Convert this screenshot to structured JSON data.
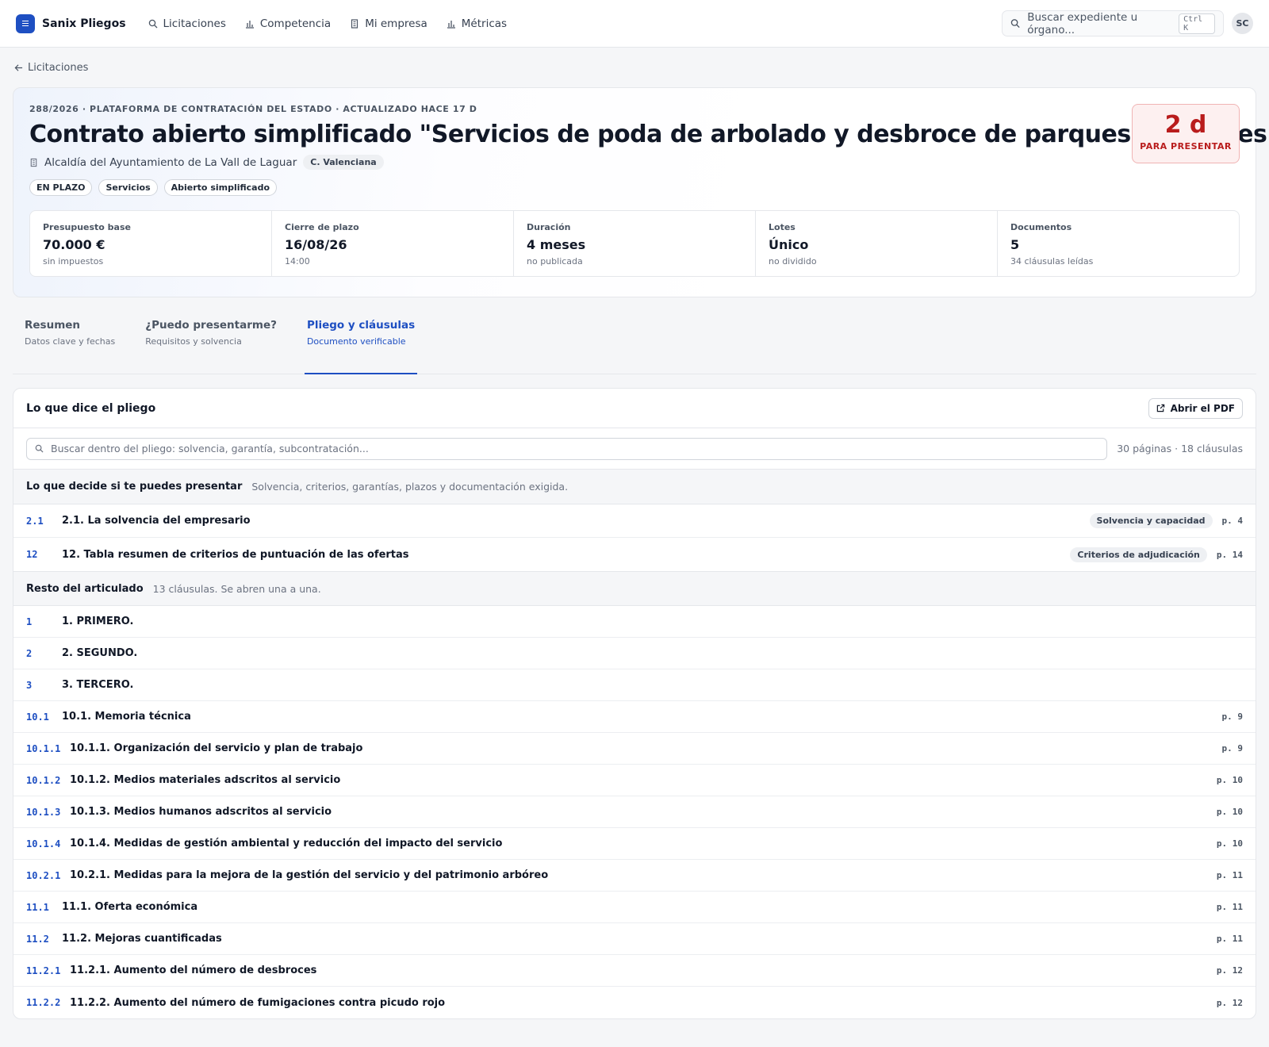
{
  "app": {
    "brand": "Sanix Pliegos"
  },
  "nav": [
    {
      "label": "Licitaciones",
      "icon": "search-icon"
    },
    {
      "label": "Competencia",
      "icon": "bar-chart-icon"
    },
    {
      "label": "Mi empresa",
      "icon": "building-icon"
    },
    {
      "label": "Métricas",
      "icon": "bar-chart-icon"
    }
  ],
  "search": {
    "placeholder": "Buscar expediente u órgano...",
    "shortcut": "Ctrl K"
  },
  "user": {
    "initials": "SC"
  },
  "breadcrumb": {
    "back_label": "Licitaciones"
  },
  "tender": {
    "meta": "288/2026 · PLATAFORMA DE CONTRATACIÓN DEL ESTADO · ACTUALIZADO HACE 17 D",
    "title": "Contrato abierto simplificado \"Servicios de poda de arbolado y desbroce de parques y jardines\"",
    "organization": "Alcaldía del Ayuntamiento de La Vall de Laguar",
    "region": "C. Valenciana",
    "tags": [
      "EN PLAZO",
      "Servicios",
      "Abierto simplificado"
    ],
    "deadline": {
      "value": "2 d",
      "label": "PARA PRESENTAR"
    },
    "stats": [
      {
        "label": "Presupuesto base",
        "value": "70.000 €",
        "sub": "sin impuestos"
      },
      {
        "label": "Cierre de plazo",
        "value": "16/08/26",
        "sub": "14:00"
      },
      {
        "label": "Duración",
        "value": "4 meses",
        "sub": "no publicada"
      },
      {
        "label": "Lotes",
        "value": "Único",
        "sub": "no dividido"
      },
      {
        "label": "Documentos",
        "value": "5",
        "sub": "34 cláusulas leídas"
      }
    ]
  },
  "tabs": [
    {
      "label": "Resumen",
      "sub": "Datos clave y fechas",
      "active": false
    },
    {
      "label": "¿Puedo presentarme?",
      "sub": "Requisitos y solvencia",
      "active": false
    },
    {
      "label": "Pliego y cláusulas",
      "sub": "Documento verificable",
      "active": true
    }
  ],
  "document": {
    "title": "Lo que dice el pliego",
    "open_pdf_label": "Abrir el PDF",
    "search_placeholder": "Buscar dentro del pliego: solvencia, garantía, subcontratación...",
    "summary": "30 páginas · 18 cláusulas",
    "key_section": {
      "title": "Lo que decide si te puedes presentar",
      "subtitle": "Solvencia, criterios, garantías, plazos y documentación exigida.",
      "clauses": [
        {
          "num": "2.1",
          "title": "2.1. La solvencia del empresario",
          "badge": "Solvencia y capacidad",
          "page": "p. 4"
        },
        {
          "num": "12",
          "title": "12. Tabla resumen de criterios de puntuación de las ofertas",
          "badge": "Criterios de adjudicación",
          "page": "p. 14"
        }
      ]
    },
    "rest_section": {
      "title": "Resto del articulado",
      "subtitle": "13 cláusulas. Se abren una a una.",
      "clauses": [
        {
          "num": "1",
          "title": "1. PRIMERO.",
          "page": ""
        },
        {
          "num": "2",
          "title": "2. SEGUNDO.",
          "page": ""
        },
        {
          "num": "3",
          "title": "3. TERCERO.",
          "page": ""
        },
        {
          "num": "10.1",
          "title": "10.1. Memoria técnica",
          "page": "p. 9"
        },
        {
          "num": "10.1.1",
          "title": "10.1.1. Organización del servicio y plan de trabajo",
          "page": "p. 9"
        },
        {
          "num": "10.1.2",
          "title": "10.1.2. Medios materiales adscritos al servicio",
          "page": "p. 10"
        },
        {
          "num": "10.1.3",
          "title": "10.1.3. Medios humanos adscritos al servicio",
          "page": "p. 10"
        },
        {
          "num": "10.1.4",
          "title": "10.1.4. Medidas de gestión ambiental y reducción del impacto del servicio",
          "page": "p. 10"
        },
        {
          "num": "10.2.1",
          "title": "10.2.1. Medidas para la mejora de la gestión del servicio y del patrimonio arbóreo",
          "page": "p. 11"
        },
        {
          "num": "11.1",
          "title": "11.1. Oferta económica",
          "page": "p. 11"
        },
        {
          "num": "11.2",
          "title": "11.2. Mejoras cuantificadas",
          "page": "p. 11"
        },
        {
          "num": "11.2.1",
          "title": "11.2.1. Aumento del número de desbroces",
          "page": "p. 12"
        },
        {
          "num": "11.2.2",
          "title": "11.2.2. Aumento del número de fumigaciones contra picudo rojo",
          "page": "p. 12"
        }
      ]
    }
  },
  "colors": {
    "accent": "#1e4fc2",
    "danger": "#b91c1c",
    "danger_bg": "#fdf0f0"
  }
}
